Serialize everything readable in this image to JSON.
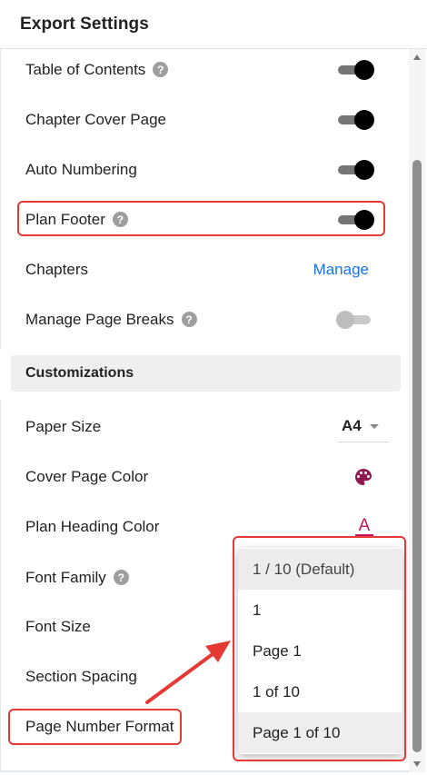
{
  "header": {
    "title": "Export Settings"
  },
  "settings": {
    "table_of_contents": {
      "label": "Table of Contents",
      "enabled": true
    },
    "chapter_cover_page": {
      "label": "Chapter Cover Page",
      "enabled": true
    },
    "auto_numbering": {
      "label": "Auto Numbering",
      "enabled": true
    },
    "plan_footer": {
      "label": "Plan Footer",
      "enabled": true
    },
    "chapters": {
      "label": "Chapters",
      "action": "Manage"
    },
    "manage_page_breaks": {
      "label": "Manage Page Breaks",
      "enabled": false
    }
  },
  "customizations": {
    "title": "Customizations",
    "paper_size": {
      "label": "Paper Size",
      "value": "A4"
    },
    "cover_page_color": {
      "label": "Cover Page Color"
    },
    "plan_heading_color": {
      "label": "Plan Heading Color",
      "icon_glyph": "A",
      "accent": "#c2185b"
    },
    "font_family": {
      "label": "Font Family"
    },
    "font_size": {
      "label": "Font Size"
    },
    "section_spacing": {
      "label": "Section Spacing"
    },
    "page_number_format": {
      "label": "Page Number Format"
    }
  },
  "help_glyph": "?",
  "page_number_options": [
    {
      "label": "1 / 10 (Default)",
      "selected": true
    },
    {
      "label": "1",
      "selected": false
    },
    {
      "label": "Page 1",
      "selected": false
    },
    {
      "label": "1 of 10",
      "selected": false
    },
    {
      "label": "Page 1 of 10",
      "selected": false,
      "hovered": true
    }
  ],
  "colors": {
    "accent_link": "#1a73e8",
    "annotation": "#e53935",
    "palette_icon": "#8e1b4f"
  }
}
